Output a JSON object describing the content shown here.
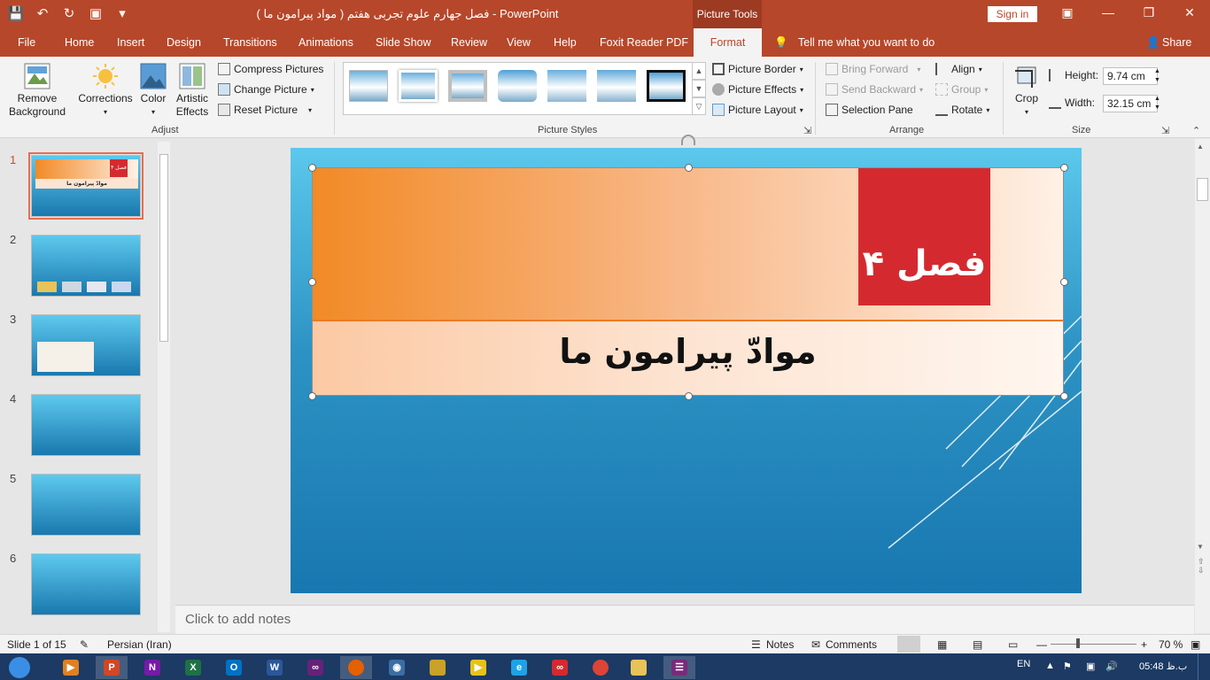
{
  "window": {
    "title": "فصل جهارم علوم تجربی هفتم ( مواد پیرامون ما )  -  PowerPoint",
    "context_tab_group": "Picture Tools",
    "sign_in": "Sign in"
  },
  "tabs": [
    {
      "label": "File"
    },
    {
      "label": "Home"
    },
    {
      "label": "Insert"
    },
    {
      "label": "Design"
    },
    {
      "label": "Transitions"
    },
    {
      "label": "Animations"
    },
    {
      "label": "Slide Show"
    },
    {
      "label": "Review"
    },
    {
      "label": "View"
    },
    {
      "label": "Help"
    },
    {
      "label": "Foxit Reader PDF"
    }
  ],
  "active_tab": "Format",
  "tell_me": "Tell me what you want to do",
  "share": "Share",
  "ribbon": {
    "adjust": {
      "label": "Adjust",
      "remove_background": "Remove Background",
      "corrections": "Corrections",
      "color": "Color",
      "artistic_effects": "Artistic Effects",
      "compress": "Compress Pictures",
      "change": "Change Picture",
      "reset": "Reset Picture"
    },
    "picture_styles": {
      "label": "Picture Styles",
      "border": "Picture Border",
      "effects": "Picture Effects",
      "layout": "Picture Layout"
    },
    "arrange": {
      "label": "Arrange",
      "bring_forward": "Bring Forward",
      "send_backward": "Send Backward",
      "selection_pane": "Selection Pane",
      "align": "Align",
      "group": "Group",
      "rotate": "Rotate"
    },
    "size": {
      "label": "Size",
      "crop": "Crop",
      "height_label": "Height:",
      "height_value": "9.74 cm",
      "width_label": "Width:",
      "width_value": "32.15 cm"
    }
  },
  "slides_panel": {
    "numbers": [
      "1",
      "2",
      "3",
      "4",
      "5",
      "6"
    ],
    "thumb1_chapter": "فصل ۴",
    "thumb1_title": "موادّ پیرامون ما"
  },
  "slide": {
    "chapter": "فصل ۴",
    "title": "موادّ پیرامون ما"
  },
  "notes_placeholder": "Click to add notes",
  "status": {
    "slide_of": "Slide 1 of 15",
    "language": "Persian (Iran)",
    "notes": "Notes",
    "comments": "Comments",
    "zoom": "70 %"
  },
  "taskbar": {
    "lang": "EN",
    "time": "05:48 ب.ظ"
  },
  "colors": {
    "accent": "#b7472a",
    "slide_red": "#d42a2f",
    "banner_orange": "#f28a26"
  }
}
